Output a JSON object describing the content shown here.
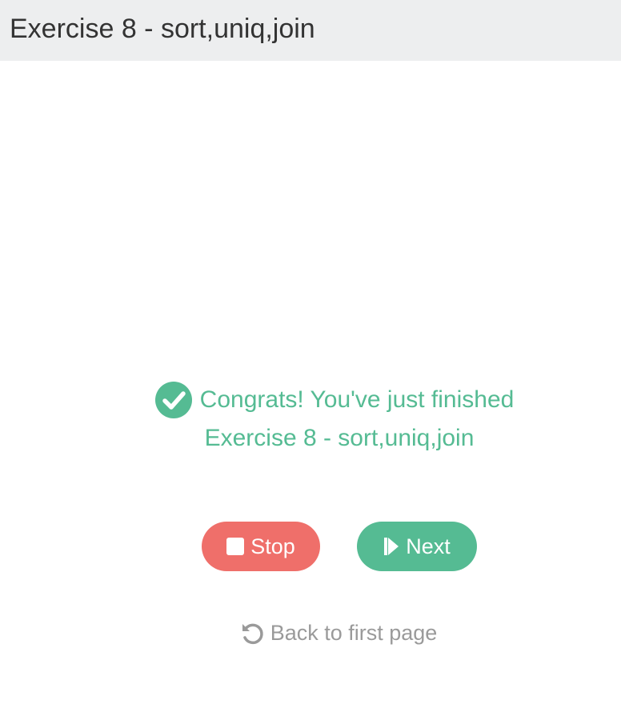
{
  "header": {
    "title": "Exercise 8 - sort,uniq,join"
  },
  "message": {
    "icon": "check-circle-icon",
    "line1": "Congrats! You've just finished",
    "line2": "Exercise 8 - sort,uniq,join",
    "color": "#55bb93"
  },
  "actions": {
    "stop_label": "Stop",
    "stop_icon": "stop-icon",
    "stop_color": "#ef6f6a",
    "next_label": "Next",
    "next_icon": "skip-next-icon",
    "next_color": "#55bb93"
  },
  "back_link": {
    "label": "Back to first page",
    "icon": "undo-icon"
  }
}
